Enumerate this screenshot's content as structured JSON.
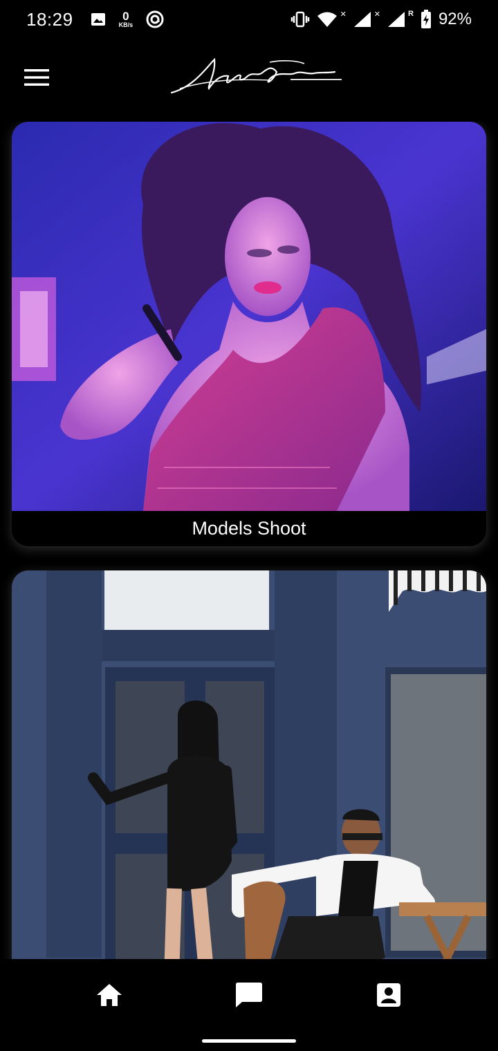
{
  "status_bar": {
    "time": "18:29",
    "net_speed_value": "0",
    "net_speed_unit": "KB/s",
    "battery": "92%",
    "icons": [
      "image-icon",
      "at-icon",
      "vibrate-icon",
      "wifi-icon",
      "signal-icon",
      "battery-charging-icon"
    ]
  },
  "app_bar": {
    "logo_alt": "Aniket Jaiswal Photography",
    "menu_icon": "hamburger-menu-icon"
  },
  "feed": {
    "cards": [
      {
        "title": "Models Shoot",
        "photo": "portrait-curly-hair-purple-light"
      },
      {
        "title": "",
        "photo": "couple-blue-building"
      }
    ]
  },
  "bottom_nav": {
    "items": [
      {
        "icon": "home-icon",
        "active": true
      },
      {
        "icon": "chat-icon",
        "active": false
      },
      {
        "icon": "contact-icon",
        "active": false
      }
    ]
  },
  "colors": {
    "background": "#000000",
    "text": "#ffffff",
    "photo1_primary": "#3b2fc9",
    "photo1_accent": "#e0409a",
    "photo2_wall": "#3d4f73"
  }
}
